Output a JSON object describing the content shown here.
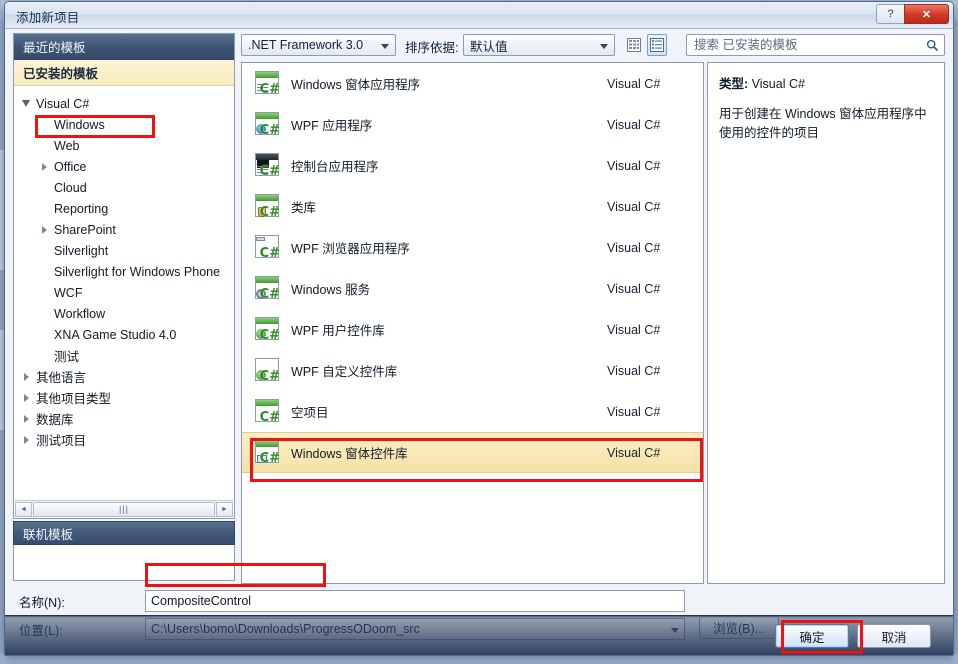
{
  "window": {
    "title": "添加新项目",
    "help_label": "?",
    "close_label": "✕"
  },
  "sidebar": {
    "recent_header": "最近的模板",
    "installed_header": "已安装的模板",
    "online_header": "联机模板",
    "scroll_thumb_glyph": "|||",
    "scroll_left_glyph": "◄",
    "scroll_right_glyph": "►",
    "tree": [
      {
        "label": "Visual C#",
        "level": 1,
        "twisty": "expanded",
        "selected": false
      },
      {
        "label": "Windows",
        "level": 2,
        "twisty": "none",
        "selected": true
      },
      {
        "label": "Web",
        "level": 2,
        "twisty": "none",
        "selected": false
      },
      {
        "label": "Office",
        "level": 2,
        "twisty": "collapsed",
        "selected": false
      },
      {
        "label": "Cloud",
        "level": 2,
        "twisty": "none",
        "selected": false
      },
      {
        "label": "Reporting",
        "level": 2,
        "twisty": "none",
        "selected": false
      },
      {
        "label": "SharePoint",
        "level": 2,
        "twisty": "collapsed",
        "selected": false
      },
      {
        "label": "Silverlight",
        "level": 2,
        "twisty": "none",
        "selected": false
      },
      {
        "label": "Silverlight for Windows Phone",
        "level": 2,
        "twisty": "none",
        "selected": false
      },
      {
        "label": "WCF",
        "level": 2,
        "twisty": "none",
        "selected": false
      },
      {
        "label": "Workflow",
        "level": 2,
        "twisty": "none",
        "selected": false
      },
      {
        "label": "XNA Game Studio 4.0",
        "level": 2,
        "twisty": "none",
        "selected": false
      },
      {
        "label": "测试",
        "level": 2,
        "twisty": "none",
        "selected": false
      },
      {
        "label": "其他语言",
        "level": 1,
        "twisty": "collapsed",
        "selected": false
      },
      {
        "label": "其他项目类型",
        "level": 1,
        "twisty": "collapsed",
        "selected": false
      },
      {
        "label": "数据库",
        "level": 1,
        "twisty": "collapsed",
        "selected": false
      },
      {
        "label": "测试项目",
        "level": 1,
        "twisty": "collapsed",
        "selected": false
      }
    ]
  },
  "toolbar": {
    "framework_value": ".NET Framework 3.0",
    "sort_label": "排序依据:",
    "sort_value": "默认值",
    "view_medium_name": "medium-icons-view",
    "view_list_name": "list-view",
    "active_view": "list"
  },
  "search": {
    "placeholder": "搜索 已安装的模板",
    "value": "",
    "icon": "search-icon"
  },
  "templates": [
    {
      "name": "Windows 窗体应用程序",
      "language": "Visual C#",
      "icon": "csharp-winforms-app-icon",
      "selected": false
    },
    {
      "name": "WPF 应用程序",
      "language": "Visual C#",
      "icon": "csharp-wpf-app-icon",
      "selected": false
    },
    {
      "name": "控制台应用程序",
      "language": "Visual C#",
      "icon": "csharp-console-app-icon",
      "selected": false
    },
    {
      "name": "类库",
      "language": "Visual C#",
      "icon": "csharp-class-library-icon",
      "selected": false
    },
    {
      "name": "WPF 浏览器应用程序",
      "language": "Visual C#",
      "icon": "csharp-wpf-browser-app-icon",
      "selected": false
    },
    {
      "name": "Windows 服务",
      "language": "Visual C#",
      "icon": "csharp-windows-service-icon",
      "selected": false
    },
    {
      "name": "WPF 用户控件库",
      "language": "Visual C#",
      "icon": "csharp-wpf-user-control-library-icon",
      "selected": false
    },
    {
      "name": "WPF 自定义控件库",
      "language": "Visual C#",
      "icon": "csharp-wpf-custom-control-library-icon",
      "selected": false
    },
    {
      "name": "空项目",
      "language": "Visual C#",
      "icon": "csharp-empty-project-icon",
      "selected": false
    },
    {
      "name": "Windows 窗体控件库",
      "language": "Visual C#",
      "icon": "csharp-winforms-control-library-icon",
      "selected": true
    }
  ],
  "description": {
    "type_label": "类型:",
    "type_value": "Visual C#",
    "text": "用于创建在 Windows 窗体应用程序中使用的控件的项目"
  },
  "form": {
    "name_label": "名称(N):",
    "name_value": "CompositeControl",
    "location_label": "位置(L):",
    "location_value": "C:\\Users\\bomo\\Downloads\\ProgressODoom_src",
    "browse_label": "浏览(B)..."
  },
  "footer": {
    "ok_label": "确定",
    "cancel_label": "取消"
  },
  "annotations": {
    "color": "#ef1212",
    "items": [
      "windows-tree-node",
      "selected-template-row",
      "name-field",
      "ok-button"
    ]
  }
}
